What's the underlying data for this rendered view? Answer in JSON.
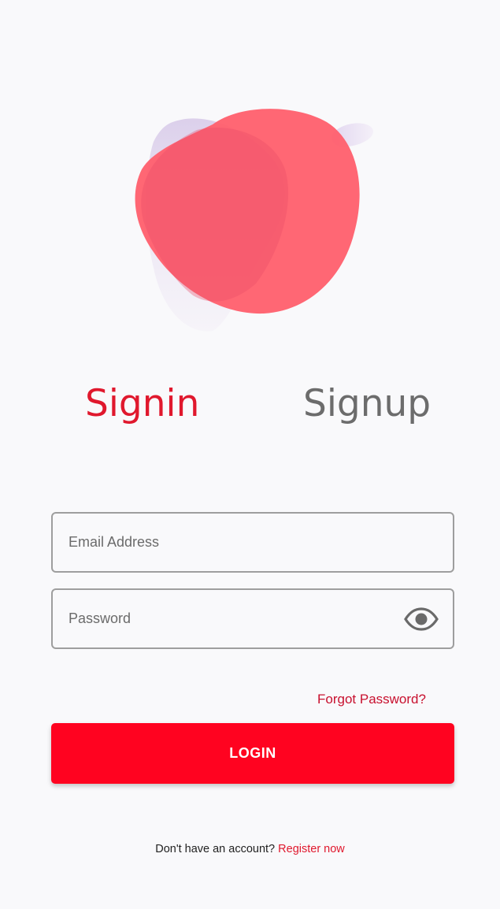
{
  "tabs": {
    "signin_label": "Signin",
    "signup_label": "Signup",
    "active": "signin"
  },
  "form": {
    "email_placeholder": "Email Address",
    "email_value": "",
    "password_placeholder": "Password",
    "password_value": "",
    "password_toggle_icon": "eye-icon",
    "forgot_label": "Forgot Password?",
    "login_label": "LOGIN"
  },
  "register": {
    "prompt": "Don't have an account?",
    "link_label": "Register now"
  },
  "colors": {
    "accent": "#e0182d",
    "button": "#ff0320",
    "blob": "#ff5f6d",
    "blob_shadow": "#d9cdea",
    "inactive_tab": "#6c6c6c"
  }
}
